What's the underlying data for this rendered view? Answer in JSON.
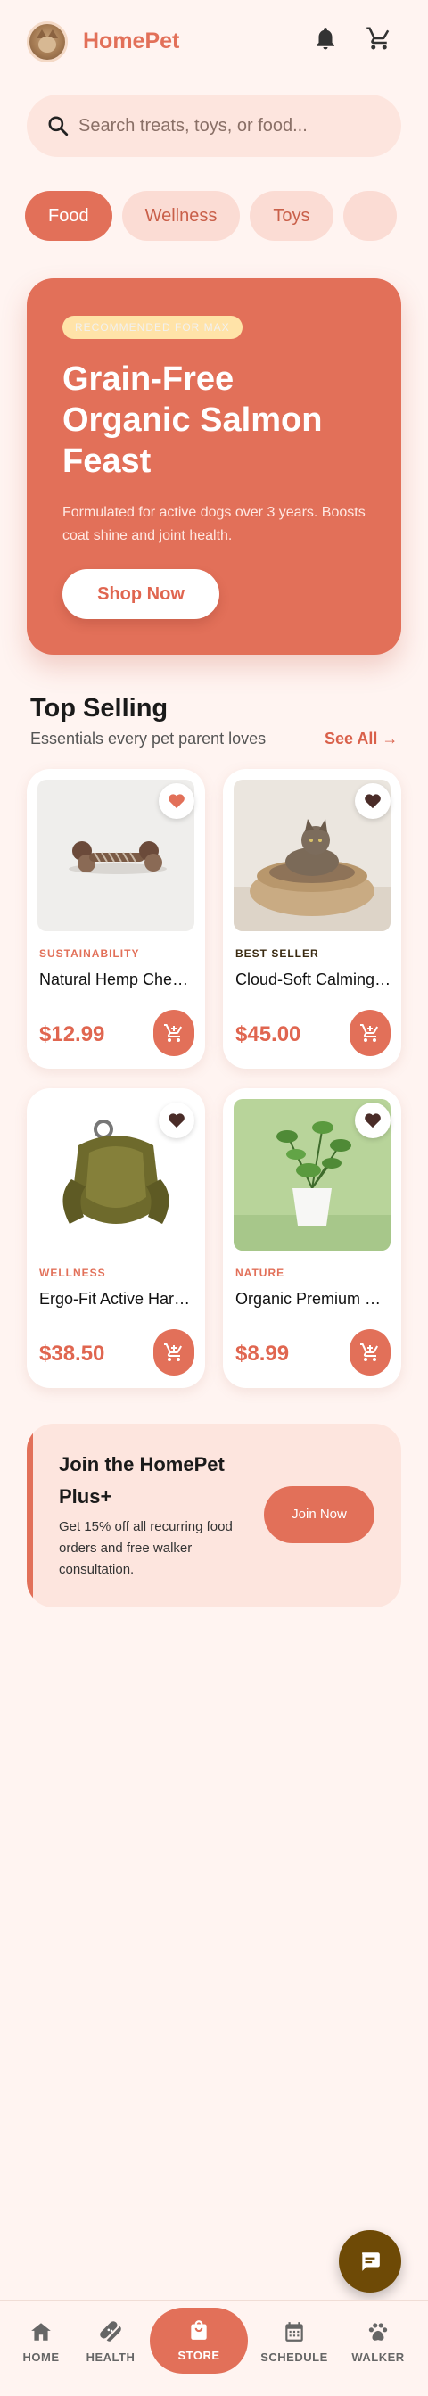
{
  "header": {
    "brand": "HomePet",
    "avatar_icon": "cat-avatar",
    "notification_icon": "bell-icon",
    "cart_icon": "cart-icon"
  },
  "search": {
    "placeholder": "Search treats, toys, or food..."
  },
  "categories": [
    {
      "label": "Food",
      "active": true
    },
    {
      "label": "Wellness",
      "active": false
    },
    {
      "label": "Toys",
      "active": false
    },
    {
      "label": "",
      "active": false
    }
  ],
  "hero": {
    "badge": "RECOMMENDED FOR MAX",
    "title": "Grain-Free Organic Salmon Feast",
    "description": "Formulated for active dogs over 3 years. Boosts coat shine and joint health.",
    "cta": "Shop Now"
  },
  "top_selling": {
    "title": "Top Selling",
    "subtitle": "Essentials every pet parent loves",
    "see_all": "See All →",
    "products": [
      {
        "category": "SUSTAINABILITY",
        "name": "Natural Hemp Chew Toy",
        "price": "$12.99",
        "favorited": true
      },
      {
        "category": "BEST SELLER",
        "name": "Cloud-Soft Calming Bed",
        "price": "$45.00",
        "favorited": false
      },
      {
        "category": "WELLNESS",
        "name": "Ergo-Fit Active Harness",
        "price": "$38.50",
        "favorited": false
      },
      {
        "category": "NATURE",
        "name": "Organic Premium Catnip",
        "price": "$8.99",
        "favorited": false
      }
    ]
  },
  "promo": {
    "title": "Join the HomePet Plus+",
    "description": "Get 15% off all recurring food orders and free walker consultation.",
    "cta": "Join Now"
  },
  "fab": {
    "icon": "chat-icon"
  },
  "nav": {
    "home": "HOME",
    "health": "HEALTH",
    "store": "STORE",
    "schedule": "SCHEDULE",
    "walker": "WALKER"
  },
  "colors": {
    "accent": "#e27059",
    "background": "#fff4f1",
    "fab": "#6e4a06"
  }
}
